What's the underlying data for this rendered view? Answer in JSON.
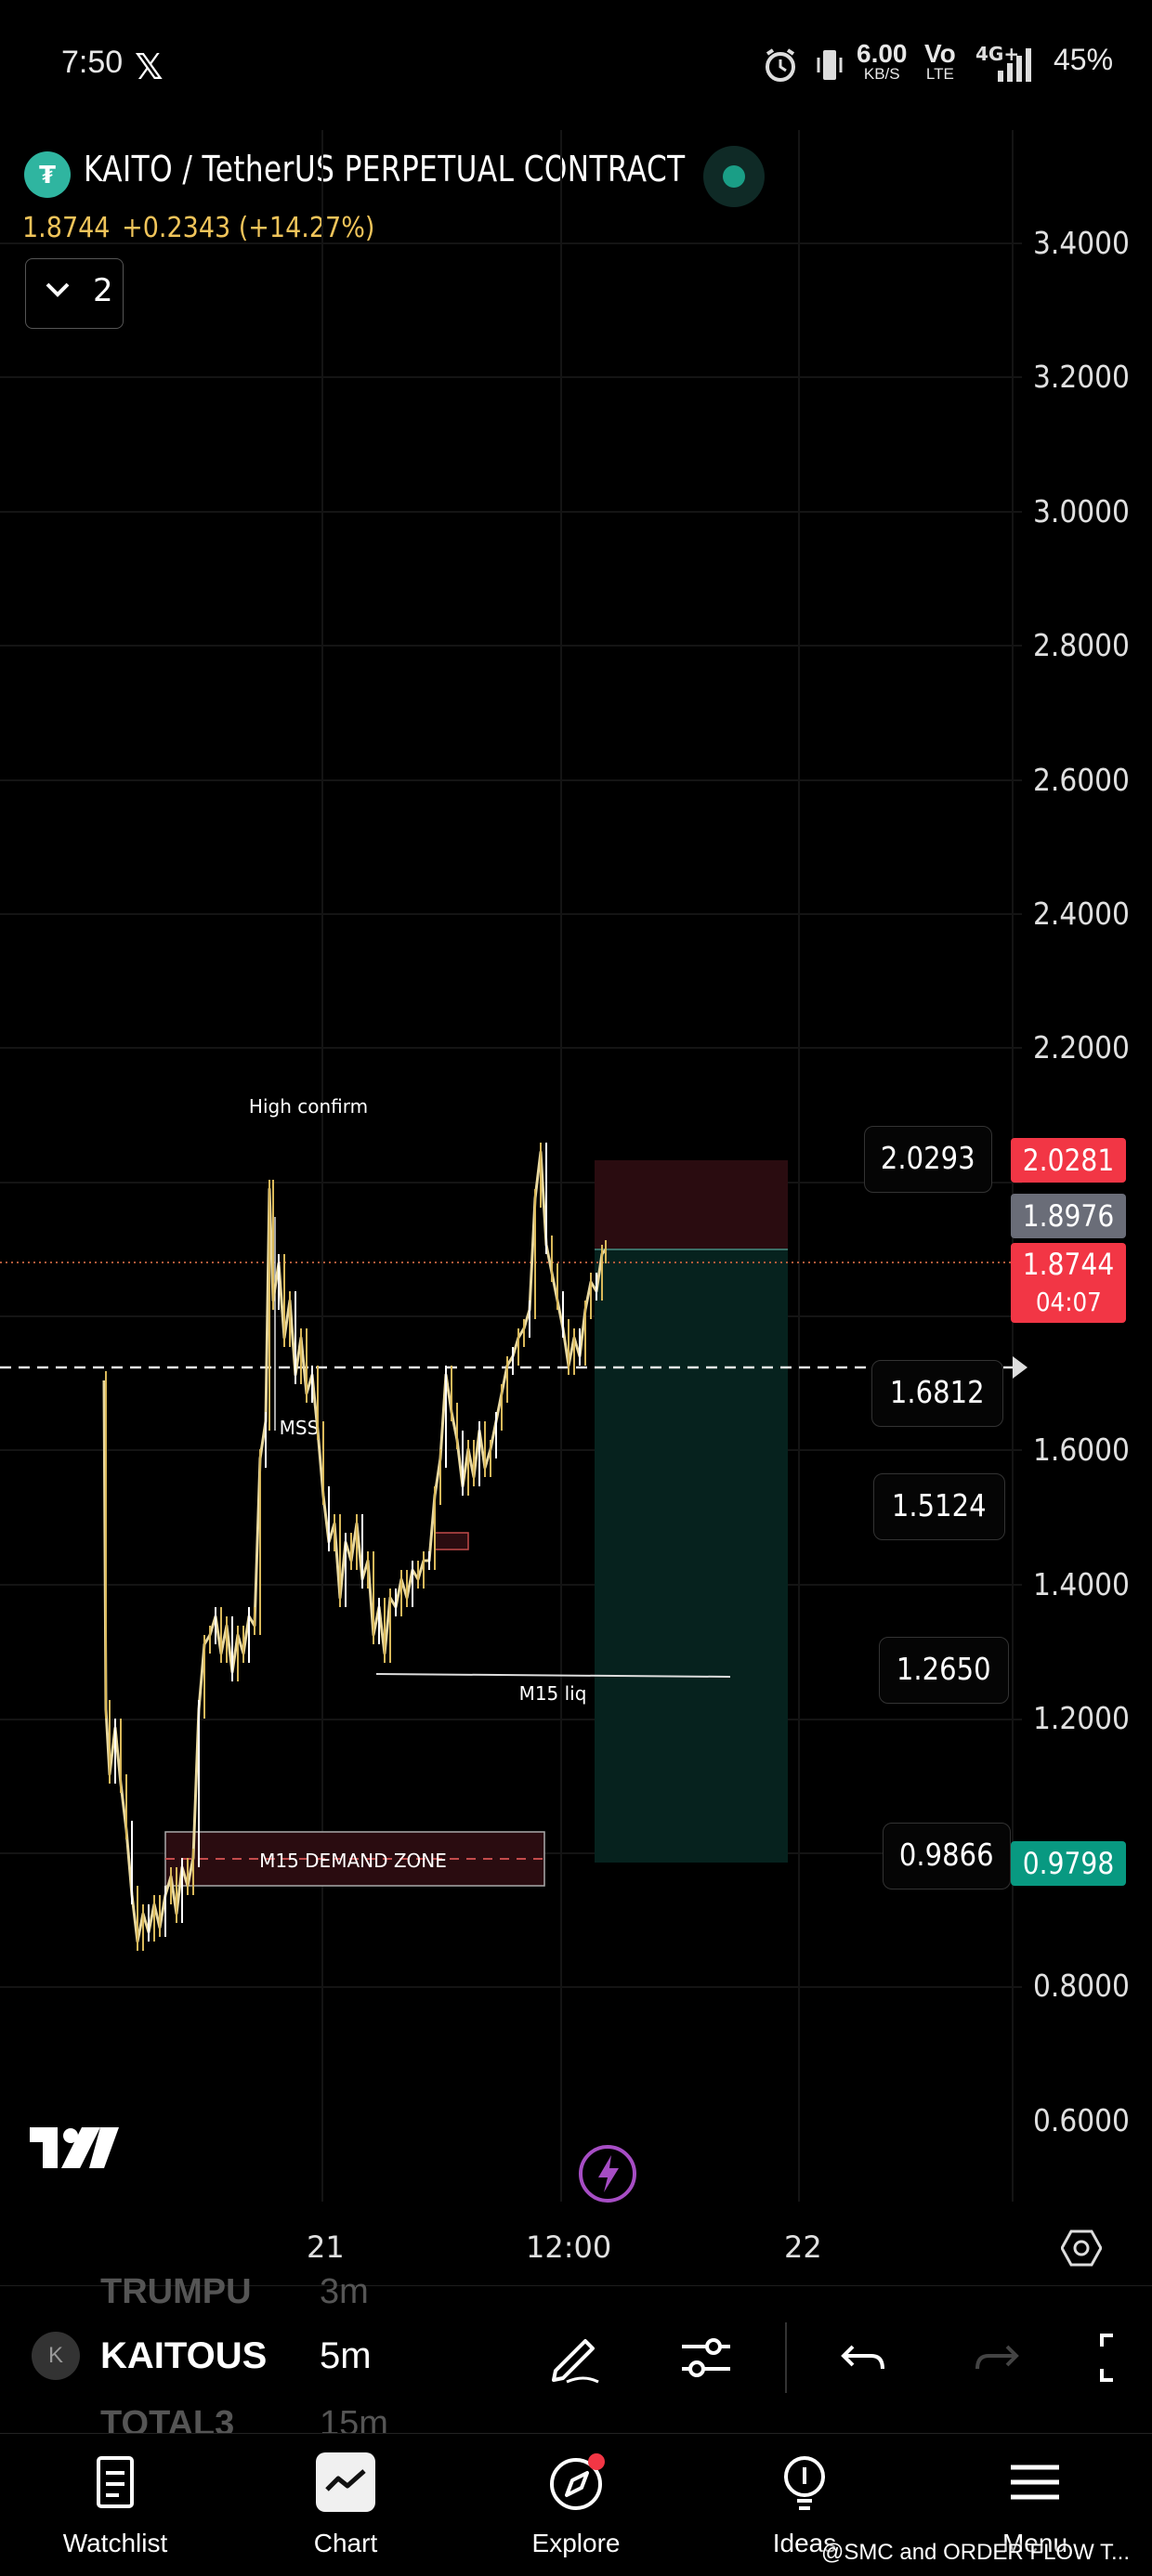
{
  "status_bar": {
    "time": "7:50",
    "x_logo": "𝕏",
    "net_speed": "6.00",
    "net_unit": "KB/S",
    "vo": "Vo",
    "lte": "LTE",
    "signal": "4G+",
    "battery": "45%"
  },
  "symbol": {
    "title": "KAITO / TetherUS PERPETUAL CONTRACT",
    "price": "1.8744",
    "change": "+0.2343 (+14.27%)",
    "indicators_count": "2"
  },
  "price_axis": [
    "3.4000",
    "3.2000",
    "3.0000",
    "2.8000",
    "2.6000",
    "2.4000",
    "2.2000",
    "1.6000",
    "1.4000",
    "1.2000",
    "0.8000",
    "0.6000"
  ],
  "price_tags": {
    "stop": "2.0281",
    "mark": "1.8976",
    "last": "1.8744",
    "countdown": "04:07",
    "target": "0.9798"
  },
  "callouts": [
    "2.0293",
    "1.6812",
    "1.5124",
    "1.2650",
    "0.9866"
  ],
  "annotations": {
    "high_confirm": "High confirm",
    "mss": "MSS",
    "m15_liq": "M15 liq",
    "demand_zone": "M15 DEMAND ZONE"
  },
  "time_axis": [
    "21",
    "12:00",
    "22"
  ],
  "toolbar": {
    "symbol": "KAITOUS",
    "symbol_above": "TRUMPU",
    "symbol_below": "TOTAL3",
    "interval": "5m",
    "interval_above": "3m",
    "interval_below": "15m",
    "symbol_badge": "K"
  },
  "bottom_nav": [
    {
      "label": "Watchlist",
      "icon": "watchlist-icon"
    },
    {
      "label": "Chart",
      "icon": "chart-icon"
    },
    {
      "label": "Explore",
      "icon": "compass-icon"
    },
    {
      "label": "Ideas",
      "icon": "lightbulb-icon"
    },
    {
      "label": "Menu",
      "icon": "menu-icon"
    }
  ],
  "watermark": "@SMC and ORDER FLOW T...",
  "colors": {
    "accent_gold": "#f0c45a",
    "red": "#f23645",
    "green": "#089981",
    "teal_zone": "#06221e",
    "red_zone": "#2a0c10"
  }
}
